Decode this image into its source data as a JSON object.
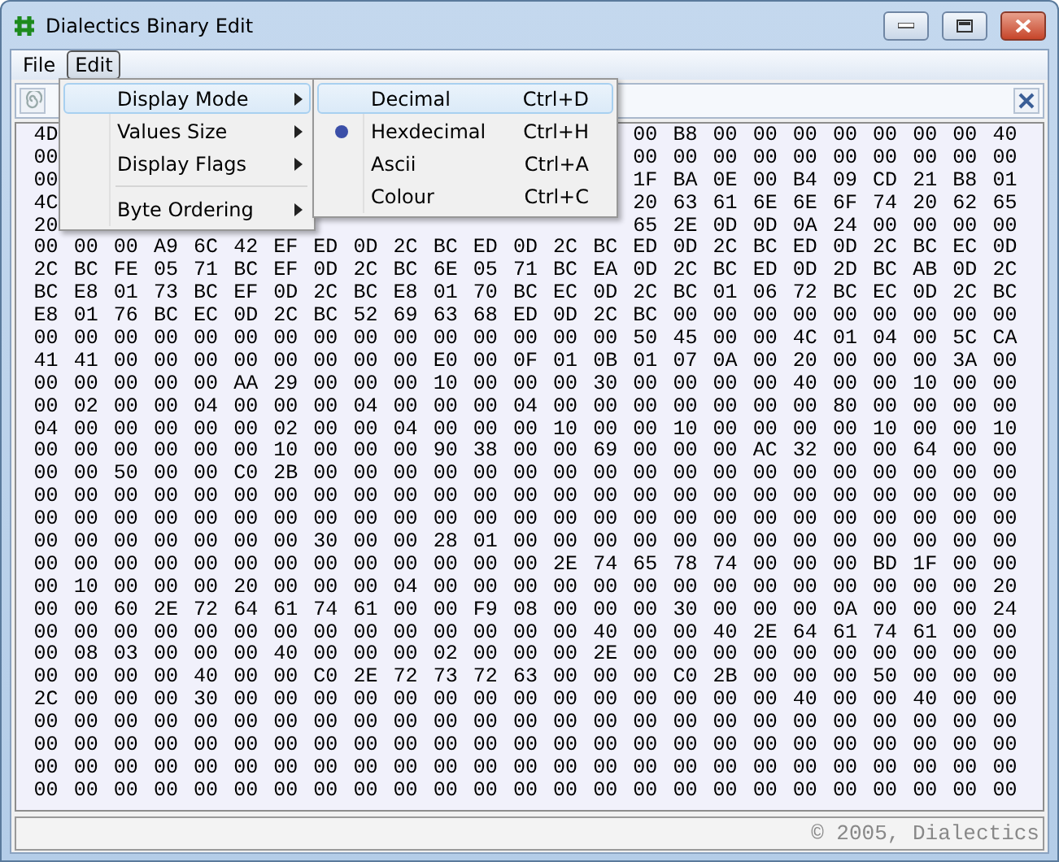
{
  "window": {
    "title": "Dialectics Binary Edit"
  },
  "menu_bar": [
    {
      "label": "File",
      "selected": false
    },
    {
      "label": "Edit",
      "selected": true
    }
  ],
  "edit_menu": [
    {
      "kind": "submenu",
      "label": "Display Mode",
      "selected": true
    },
    {
      "kind": "submenu",
      "label": "Values Size",
      "selected": false
    },
    {
      "kind": "submenu",
      "label": "Display Flags",
      "selected": false
    },
    {
      "kind": "separator"
    },
    {
      "kind": "submenu",
      "label": "Byte Ordering",
      "selected": false
    }
  ],
  "display_mode_menu": [
    {
      "label": "Decimal",
      "shortcut": "Ctrl+D",
      "selected": true,
      "checked": false
    },
    {
      "label": "Hexdecimal",
      "shortcut": "Ctrl+H",
      "selected": false,
      "checked": true
    },
    {
      "label": "Ascii",
      "shortcut": "Ctrl+A",
      "selected": false,
      "checked": false
    },
    {
      "label": "Colour",
      "shortcut": "Ctrl+C",
      "selected": false,
      "checked": false
    }
  ],
  "hex_rows": [
    {
      "lead": [
        "4D"
      ],
      "trail": [
        "00",
        "B8",
        "00",
        "00",
        "00",
        "00",
        "00",
        "00",
        "00",
        "40"
      ]
    },
    {
      "lead": [
        "00"
      ],
      "trail": [
        "00",
        "00",
        "00",
        "00",
        "00",
        "00",
        "00",
        "00",
        "00",
        "00"
      ]
    },
    {
      "lead": [
        "00"
      ],
      "trail": [
        "1F",
        "BA",
        "0E",
        "00",
        "B4",
        "09",
        "CD",
        "21",
        "B8",
        "01"
      ]
    },
    {
      "lead": [
        "4C"
      ],
      "trail": [
        "20",
        "63",
        "61",
        "6E",
        "6E",
        "6F",
        "74",
        "20",
        "62",
        "65"
      ]
    },
    {
      "lead": [
        "20"
      ],
      "trail": [
        "65",
        "2E",
        "0D",
        "0D",
        "0A",
        "24",
        "00",
        "00",
        "00",
        "00"
      ]
    },
    {
      "cells": [
        "00",
        "00",
        "00",
        "A9",
        "6C",
        "42",
        "EF",
        "ED",
        "0D",
        "2C",
        "BC",
        "ED",
        "0D",
        "2C",
        "BC",
        "ED",
        "0D",
        "2C",
        "BC",
        "ED",
        "0D",
        "2C",
        "BC",
        "EC",
        "0D"
      ]
    },
    {
      "cells": [
        "2C",
        "BC",
        "FE",
        "05",
        "71",
        "BC",
        "EF",
        "0D",
        "2C",
        "BC",
        "6E",
        "05",
        "71",
        "BC",
        "EA",
        "0D",
        "2C",
        "BC",
        "ED",
        "0D",
        "2D",
        "BC",
        "AB",
        "0D",
        "2C"
      ]
    },
    {
      "cells": [
        "BC",
        "E8",
        "01",
        "73",
        "BC",
        "EF",
        "0D",
        "2C",
        "BC",
        "E8",
        "01",
        "70",
        "BC",
        "EC",
        "0D",
        "2C",
        "BC",
        "01",
        "06",
        "72",
        "BC",
        "EC",
        "0D",
        "2C",
        "BC"
      ]
    },
    {
      "cells": [
        "E8",
        "01",
        "76",
        "BC",
        "EC",
        "0D",
        "2C",
        "BC",
        "52",
        "69",
        "63",
        "68",
        "ED",
        "0D",
        "2C",
        "BC",
        "00",
        "00",
        "00",
        "00",
        "00",
        "00",
        "00",
        "00",
        "00"
      ]
    },
    {
      "cells": [
        "00",
        "00",
        "00",
        "00",
        "00",
        "00",
        "00",
        "00",
        "00",
        "00",
        "00",
        "00",
        "00",
        "00",
        "00",
        "50",
        "45",
        "00",
        "00",
        "4C",
        "01",
        "04",
        "00",
        "5C",
        "CA"
      ]
    },
    {
      "cells": [
        "41",
        "41",
        "00",
        "00",
        "00",
        "00",
        "00",
        "00",
        "00",
        "00",
        "E0",
        "00",
        "0F",
        "01",
        "0B",
        "01",
        "07",
        "0A",
        "00",
        "20",
        "00",
        "00",
        "00",
        "3A",
        "00"
      ]
    },
    {
      "cells": [
        "00",
        "00",
        "00",
        "00",
        "00",
        "AA",
        "29",
        "00",
        "00",
        "00",
        "10",
        "00",
        "00",
        "00",
        "30",
        "00",
        "00",
        "00",
        "00",
        "40",
        "00",
        "00",
        "10",
        "00",
        "00"
      ]
    },
    {
      "cells": [
        "00",
        "02",
        "00",
        "00",
        "04",
        "00",
        "00",
        "00",
        "04",
        "00",
        "00",
        "00",
        "04",
        "00",
        "00",
        "00",
        "00",
        "00",
        "00",
        "00",
        "80",
        "00",
        "00",
        "00",
        "00"
      ]
    },
    {
      "cells": [
        "04",
        "00",
        "00",
        "00",
        "00",
        "00",
        "02",
        "00",
        "00",
        "04",
        "00",
        "00",
        "00",
        "10",
        "00",
        "00",
        "10",
        "00",
        "00",
        "00",
        "00",
        "10",
        "00",
        "00",
        "10"
      ]
    },
    {
      "cells": [
        "00",
        "00",
        "00",
        "00",
        "00",
        "00",
        "10",
        "00",
        "00",
        "00",
        "90",
        "38",
        "00",
        "00",
        "69",
        "00",
        "00",
        "00",
        "AC",
        "32",
        "00",
        "00",
        "64",
        "00",
        "00"
      ]
    },
    {
      "cells": [
        "00",
        "00",
        "50",
        "00",
        "00",
        "C0",
        "2B",
        "00",
        "00",
        "00",
        "00",
        "00",
        "00",
        "00",
        "00",
        "00",
        "00",
        "00",
        "00",
        "00",
        "00",
        "00",
        "00",
        "00",
        "00"
      ]
    },
    {
      "cells": [
        "00",
        "00",
        "00",
        "00",
        "00",
        "00",
        "00",
        "00",
        "00",
        "00",
        "00",
        "00",
        "00",
        "00",
        "00",
        "00",
        "00",
        "00",
        "00",
        "00",
        "00",
        "00",
        "00",
        "00",
        "00"
      ]
    },
    {
      "cells": [
        "00",
        "00",
        "00",
        "00",
        "00",
        "00",
        "00",
        "00",
        "00",
        "00",
        "00",
        "00",
        "00",
        "00",
        "00",
        "00",
        "00",
        "00",
        "00",
        "00",
        "00",
        "00",
        "00",
        "00",
        "00"
      ]
    },
    {
      "cells": [
        "00",
        "00",
        "00",
        "00",
        "00",
        "00",
        "00",
        "30",
        "00",
        "00",
        "28",
        "01",
        "00",
        "00",
        "00",
        "00",
        "00",
        "00",
        "00",
        "00",
        "00",
        "00",
        "00",
        "00",
        "00"
      ]
    },
    {
      "cells": [
        "00",
        "00",
        "00",
        "00",
        "00",
        "00",
        "00",
        "00",
        "00",
        "00",
        "00",
        "00",
        "00",
        "2E",
        "74",
        "65",
        "78",
        "74",
        "00",
        "00",
        "00",
        "BD",
        "1F",
        "00",
        "00"
      ]
    },
    {
      "cells": [
        "00",
        "10",
        "00",
        "00",
        "00",
        "20",
        "00",
        "00",
        "00",
        "04",
        "00",
        "00",
        "00",
        "00",
        "00",
        "00",
        "00",
        "00",
        "00",
        "00",
        "00",
        "00",
        "00",
        "00",
        "20"
      ]
    },
    {
      "cells": [
        "00",
        "00",
        "60",
        "2E",
        "72",
        "64",
        "61",
        "74",
        "61",
        "00",
        "00",
        "F9",
        "08",
        "00",
        "00",
        "00",
        "30",
        "00",
        "00",
        "00",
        "0A",
        "00",
        "00",
        "00",
        "24"
      ]
    },
    {
      "cells": [
        "00",
        "00",
        "00",
        "00",
        "00",
        "00",
        "00",
        "00",
        "00",
        "00",
        "00",
        "00",
        "00",
        "00",
        "40",
        "00",
        "00",
        "40",
        "2E",
        "64",
        "61",
        "74",
        "61",
        "00",
        "00"
      ]
    },
    {
      "cells": [
        "00",
        "08",
        "03",
        "00",
        "00",
        "00",
        "40",
        "00",
        "00",
        "00",
        "02",
        "00",
        "00",
        "00",
        "2E",
        "00",
        "00",
        "00",
        "00",
        "00",
        "00",
        "00",
        "00",
        "00",
        "00"
      ]
    },
    {
      "cells": [
        "00",
        "00",
        "00",
        "00",
        "40",
        "00",
        "00",
        "C0",
        "2E",
        "72",
        "73",
        "72",
        "63",
        "00",
        "00",
        "00",
        "C0",
        "2B",
        "00",
        "00",
        "00",
        "50",
        "00",
        "00",
        "00"
      ]
    },
    {
      "cells": [
        "2C",
        "00",
        "00",
        "00",
        "30",
        "00",
        "00",
        "00",
        "00",
        "00",
        "00",
        "00",
        "00",
        "00",
        "00",
        "00",
        "00",
        "00",
        "00",
        "40",
        "00",
        "00",
        "40",
        "00",
        "00"
      ]
    },
    {
      "cells": [
        "00",
        "00",
        "00",
        "00",
        "00",
        "00",
        "00",
        "00",
        "00",
        "00",
        "00",
        "00",
        "00",
        "00",
        "00",
        "00",
        "00",
        "00",
        "00",
        "00",
        "00",
        "00",
        "00",
        "00",
        "00"
      ]
    },
    {
      "cells": [
        "00",
        "00",
        "00",
        "00",
        "00",
        "00",
        "00",
        "00",
        "00",
        "00",
        "00",
        "00",
        "00",
        "00",
        "00",
        "00",
        "00",
        "00",
        "00",
        "00",
        "00",
        "00",
        "00",
        "00",
        "00"
      ]
    },
    {
      "cells": [
        "00",
        "00",
        "00",
        "00",
        "00",
        "00",
        "00",
        "00",
        "00",
        "00",
        "00",
        "00",
        "00",
        "00",
        "00",
        "00",
        "00",
        "00",
        "00",
        "00",
        "00",
        "00",
        "00",
        "00",
        "00"
      ]
    },
    {
      "cells": [
        "00",
        "00",
        "00",
        "00",
        "00",
        "00",
        "00",
        "00",
        "00",
        "00",
        "00",
        "00",
        "00",
        "00",
        "00",
        "00",
        "00",
        "00",
        "00",
        "00",
        "00",
        "00",
        "00",
        "00",
        "00"
      ]
    }
  ],
  "status_bar": {
    "text": "© 2005, Dialectics"
  }
}
